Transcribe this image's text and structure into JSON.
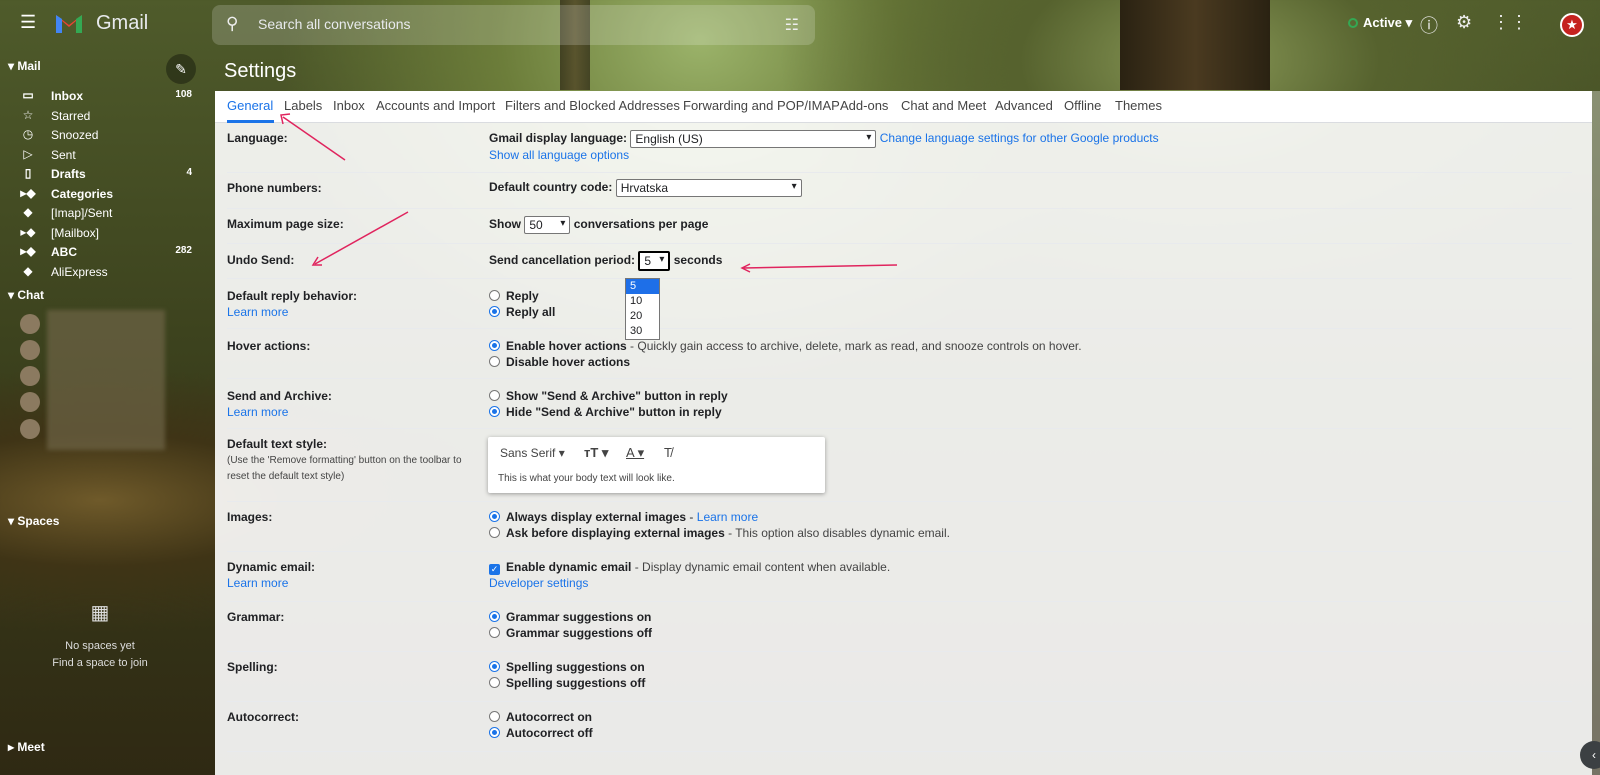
{
  "app": {
    "name": "Gmail"
  },
  "search": {
    "placeholder": "Search all conversations"
  },
  "status": {
    "label": "Active"
  },
  "sidebar": {
    "mail_header": "Mail",
    "items": [
      {
        "label": "Inbox",
        "count": "108",
        "bold": true
      },
      {
        "label": "Starred",
        "count": ""
      },
      {
        "label": "Snoozed",
        "count": ""
      },
      {
        "label": "Sent",
        "count": ""
      },
      {
        "label": "Drafts",
        "count": "4",
        "bold": true
      },
      {
        "label": "Categories",
        "count": "",
        "bold": true
      },
      {
        "label": "[Imap]/Sent",
        "count": ""
      },
      {
        "label": "[Mailbox]",
        "count": ""
      },
      {
        "label": "ABC",
        "count": "282",
        "bold": true
      },
      {
        "label": "AliExpress",
        "count": ""
      }
    ],
    "chat_header": "Chat",
    "spaces_header": "Spaces",
    "spaces_empty": "No spaces yet",
    "spaces_link": "Find a space to join",
    "meet_header": "Meet"
  },
  "settings": {
    "title": "Settings",
    "tabs": [
      "General",
      "Labels",
      "Inbox",
      "Accounts and Import",
      "Filters and Blocked Addresses",
      "Forwarding and POP/IMAP",
      "Add-ons",
      "Chat and Meet",
      "Advanced",
      "Offline",
      "Themes"
    ],
    "language": {
      "label": "Language:",
      "display_label": "Gmail display language:",
      "value": "English (US)",
      "change_link": "Change language settings for other Google products",
      "show_all": "Show all language options"
    },
    "phone": {
      "label": "Phone numbers:",
      "country_label": "Default country code:",
      "value": "Hrvatska"
    },
    "page_size": {
      "label": "Maximum page size:",
      "show": "Show",
      "value": "50",
      "suffix": "conversations per page"
    },
    "undo_send": {
      "label": "Undo Send:",
      "period_label": "Send cancellation period:",
      "value": "5",
      "suffix": "seconds",
      "options": [
        "5",
        "10",
        "20",
        "30"
      ]
    },
    "reply": {
      "label": "Default reply behavior:",
      "learn": "Learn more",
      "opt1": "Reply",
      "opt2": "Reply all"
    },
    "hover": {
      "label": "Hover actions:",
      "opt1": "Enable hover actions",
      "opt1_desc": " - Quickly gain access to archive, delete, mark as read, and snooze controls on hover.",
      "opt2": "Disable hover actions"
    },
    "send_archive": {
      "label": "Send and Archive:",
      "learn": "Learn more",
      "opt1": "Show \"Send & Archive\" button in reply",
      "opt2": "Hide \"Send & Archive\" button in reply"
    },
    "text_style": {
      "label": "Default text style:",
      "note": "(Use the 'Remove formatting' button on the toolbar to reset the default text style)",
      "font": "Sans Serif",
      "preview": "This is what your body text will look like."
    },
    "images": {
      "label": "Images:",
      "opt1": "Always display external images",
      "opt1_link": "Learn more",
      "opt2": "Ask before displaying external images",
      "opt2_desc": " - This option also disables dynamic email."
    },
    "dynamic": {
      "label": "Dynamic email:",
      "learn": "Learn more",
      "opt1": "Enable dynamic email",
      "opt1_desc": " - Display dynamic email content when available.",
      "dev": "Developer settings"
    },
    "grammar": {
      "label": "Grammar:",
      "opt1": "Grammar suggestions on",
      "opt2": "Grammar suggestions off"
    },
    "spelling": {
      "label": "Spelling:",
      "opt1": "Spelling suggestions on",
      "opt2": "Spelling suggestions off"
    },
    "autocorrect": {
      "label": "Autocorrect:",
      "opt1": "Autocorrect on",
      "opt2": "Autocorrect off"
    }
  }
}
